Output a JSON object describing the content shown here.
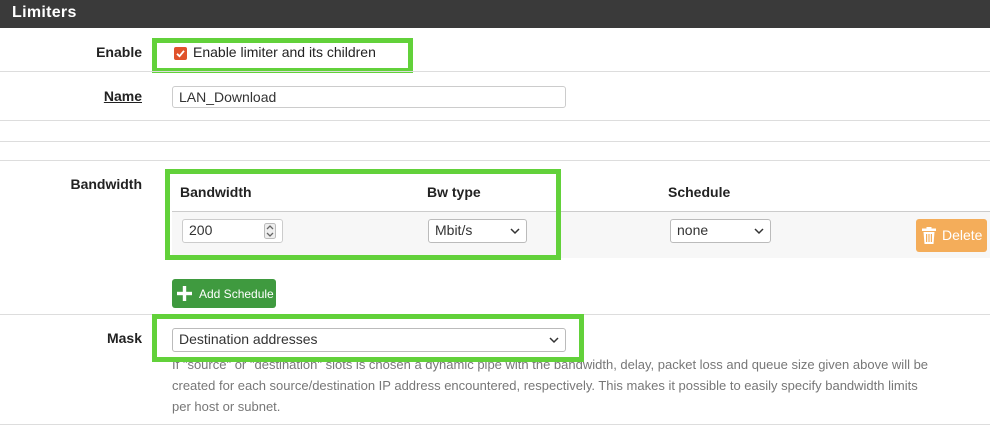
{
  "panel": {
    "title": "Limiters"
  },
  "enable": {
    "label": "Enable",
    "checkbox_label": "Enable limiter and its children",
    "checked": true
  },
  "name": {
    "label": "Name",
    "value": "LAN_Download"
  },
  "bandwidth": {
    "label": "Bandwidth",
    "columns": {
      "bandwidth": "Bandwidth",
      "bw_type": "Bw type",
      "schedule": "Schedule"
    },
    "row": {
      "value": "200",
      "bw_type": "Mbit/s",
      "schedule": "none"
    },
    "delete_label": "Delete",
    "add_schedule_label": "Add Schedule"
  },
  "mask": {
    "label": "Mask",
    "value": "Destination addresses",
    "help_lines": [
      "If \"source\" or \"destination\" slots is chosen a dynamic pipe with the bandwidth, delay, packet loss and queue size given above will be",
      "created for each source/destination IP address encountered, respectively. This makes it possible to easily specify bandwidth limits",
      "per host or subnet."
    ]
  },
  "colors": {
    "header_bg": "#3a3a3a",
    "checkbox": "#e0522b",
    "highlight": "#62d13a",
    "add_button": "#3f9a3f",
    "delete_button": "#f4ad5a"
  }
}
